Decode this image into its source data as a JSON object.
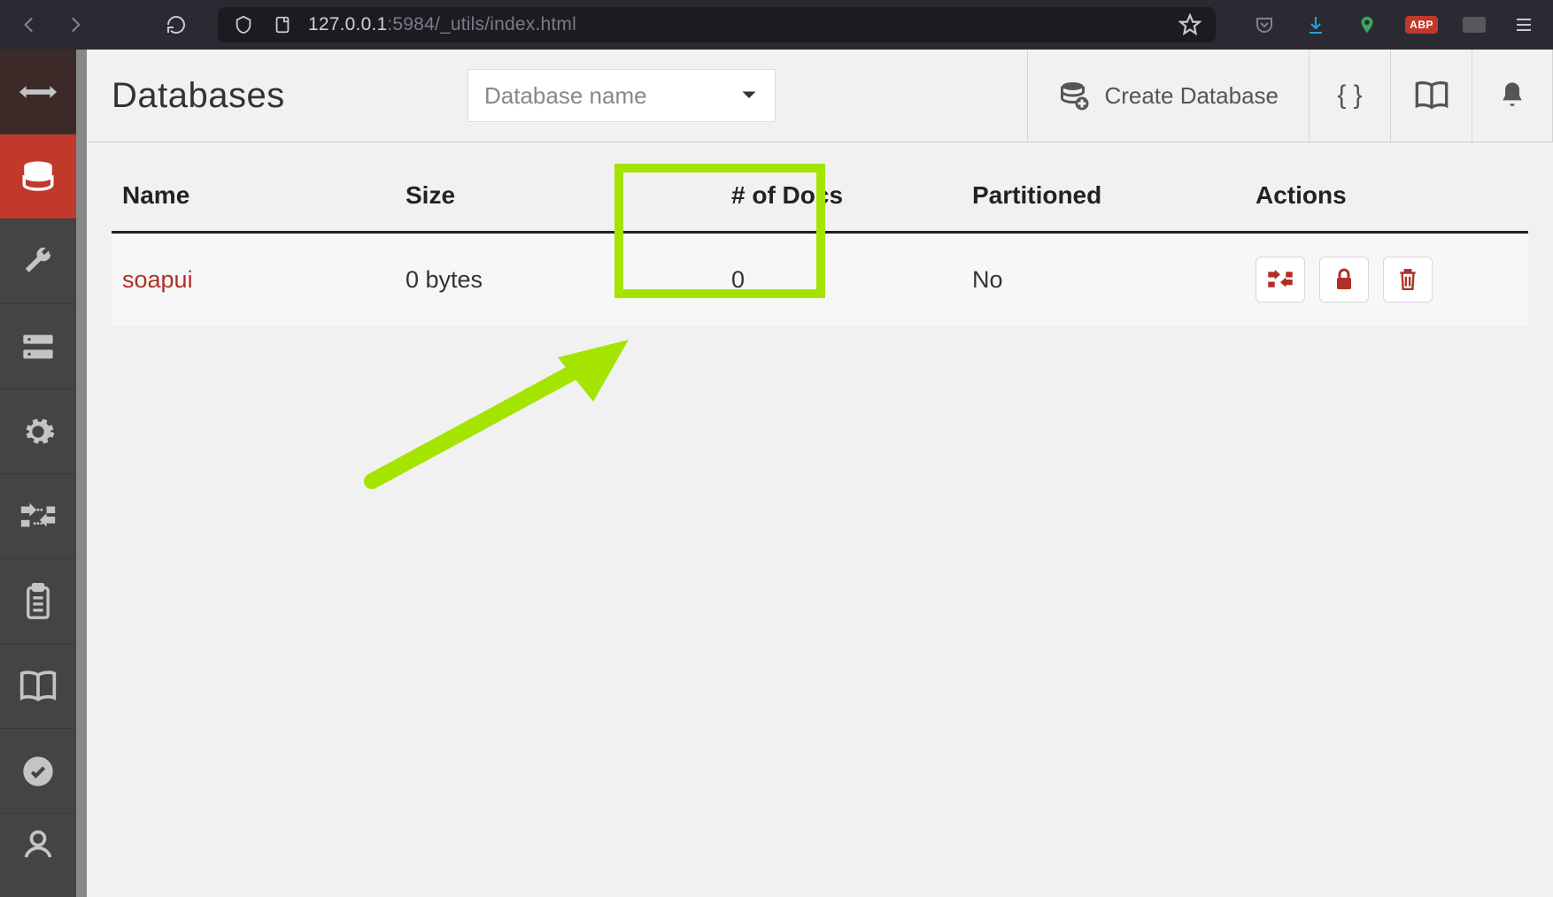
{
  "browser": {
    "url_prefix": "127.0.0.1",
    "url_port_path": ":5984/_utils/index.html",
    "adblock": "ABP"
  },
  "page": {
    "title": "Databases",
    "db_select_placeholder": "Database name",
    "create_db": "Create Database"
  },
  "table": {
    "headers": {
      "name": "Name",
      "size": "Size",
      "docs": "# of Docs",
      "partitioned": "Partitioned",
      "actions": "Actions"
    },
    "rows": [
      {
        "name": "soapui",
        "size": "0 bytes",
        "docs": "0",
        "partitioned": "No"
      }
    ]
  }
}
